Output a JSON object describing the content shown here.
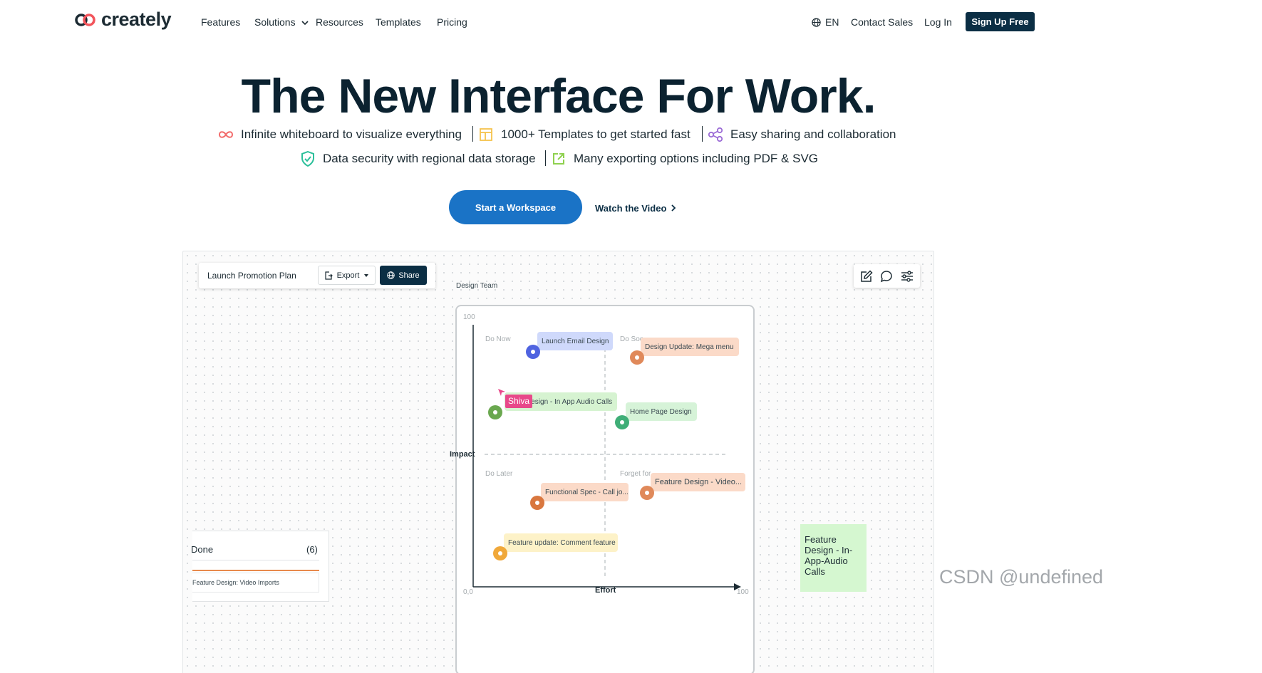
{
  "logo": {
    "text": "creately"
  },
  "nav": {
    "features": "Features",
    "solutions": "Solutions",
    "resources": "Resources",
    "templates": "Templates",
    "pricing": "Pricing",
    "language": "EN",
    "contact_sales": "Contact Sales",
    "log_in": "Log In",
    "sign_up": "Sign Up Free"
  },
  "hero": {
    "title": "The New Interface For Work.",
    "features": [
      {
        "icon": "infinity-icon",
        "text": "Infinite whiteboard to visualize everything",
        "color": "#f26b6b"
      },
      {
        "icon": "template-icon",
        "text": "1000+ Templates to get started fast",
        "color": "#f5c34d"
      },
      {
        "icon": "share-icon",
        "text": "Easy sharing and collaboration",
        "color": "#9b6bd6"
      },
      {
        "icon": "shield-check-icon",
        "text": "Data security with regional data storage",
        "color": "#2bbf9a"
      },
      {
        "icon": "export-icon",
        "text": "Many exporting options including PDF & SVG",
        "color": "#8fd14f"
      }
    ],
    "cta_primary": "Start a Workspace",
    "cta_secondary": "Watch the Video"
  },
  "app": {
    "document_title": "Launch Promotion Plan",
    "export_label": "Export",
    "share_label": "Share",
    "frame_label": "Design Team",
    "axis": {
      "y_label": "Impact",
      "x_label": "Effort",
      "y_max": "100",
      "x_min": "0,0",
      "x_max": "100"
    },
    "quadrants": {
      "top_left": "Do Now",
      "top_right": "Do Soo",
      "bottom_left": "Do Later",
      "bottom_right": "Forget for"
    },
    "cards": [
      {
        "text": "Launch Email Design",
        "bg": "#cfd9fb",
        "dot": "#4f63e0"
      },
      {
        "text": "Design Update: Mega menu",
        "bg": "#fbdac8",
        "dot": "#e0895a"
      },
      {
        "text": "Design - In App Audio Calls",
        "bg": "#d6f3d1",
        "dot": "#6aa84f"
      },
      {
        "text": "Home Page Design",
        "bg": "#d6f3d8",
        "dot": "#3fae77"
      },
      {
        "text": "Functional Spec - Call jo...",
        "bg": "#fbdac8",
        "dot": "#d9773f"
      },
      {
        "text": "Feature Design - Video...",
        "bg": "#fbdac8",
        "dot": "#e0895a"
      },
      {
        "text": "Feature update: Comment feature",
        "bg": "#fdf2c8",
        "dot": "#f0a83a"
      }
    ],
    "cursor_user": "Shiva",
    "done_panel": {
      "title": "Done",
      "count": "(6)",
      "item": "Feature Design: Video Imports"
    },
    "sticky_note": "Feature Design - In-App-Audio Calls"
  },
  "watermark": "CSDN @undefined"
}
